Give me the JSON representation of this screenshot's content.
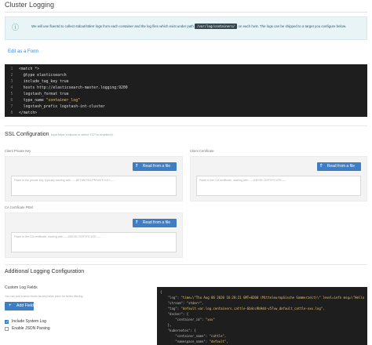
{
  "page": {
    "title": "Cluster Logging"
  },
  "info": {
    "text_before": "We will use fluentd to collect stdout/stderr logs from each container and the log files which exist under path ",
    "path": "/var/log/containers/",
    "text_after": " on each host. The logs can be shipped to a target you configure below."
  },
  "edit_link": "Edit as a Form",
  "editor": {
    "lines": [
      {
        "n": "1",
        "text": "<match *>"
      },
      {
        "n": "2",
        "text": "  @type elasticsearch"
      },
      {
        "n": "3",
        "text": "  include_tag_key true"
      },
      {
        "n": "4",
        "text": "  hosts http://elasticsearch-master.logging:9200"
      },
      {
        "n": "5",
        "text": "  logstash_format true"
      },
      {
        "n": "6",
        "text": "  type_name \"container_log\""
      },
      {
        "n": "7",
        "text": "  logstash_prefix logstash-int-cluster"
      },
      {
        "n": "8",
        "text": "</match>"
      }
    ]
  },
  "ssl": {
    "title": "SSL Configuration",
    "subtitle": "Input https endpoint or select TCP to enabled it.",
    "client_key": {
      "label": "Client Private Key",
      "button": "Read from a file",
      "placeholder": "Paste in the private key, typically starting with -----BEGIN RSA PRIVATE KEY-----"
    },
    "client_cert": {
      "label": "Client Certificate",
      "button": "Read from a file",
      "placeholder": "Paste in the CA certificate, starting with -----BEGIN CERTIFICATE-----"
    },
    "ca_cert": {
      "label": "CA Certificate PEM",
      "button": "Read from a file",
      "placeholder": "Paste in the CA certificate, starting with -----BEGIN CERTIFICATE-----"
    }
  },
  "additional": {
    "title": "Additional Logging Configuration",
    "fields_label": "Custom Log Fields",
    "fields_help": "You can add custom fields as key/value pairs for better filtering",
    "add_field": "Add Field",
    "include_system_log": "Include System Log",
    "include_system_log_checked": true,
    "enable_json": "Enable JSON Parsing",
    "enable_json_checked": false
  },
  "preview": {
    "lines": [
      "{",
      "    \"log\": \"time=\\\"Thu Aug 06 2020 16:28:21 GMT+0200 (Mitteleuropäische Sommerzeit)\\\" level=info msg=\\\"Hello World\\\"\",",
      "    \"stream\": \"stderr\",",
      "    \"tag\": \"default.var.log.containers.cattle-6b4cc9b9dd-v57vw_default_cattle-xxx.log\",",
      "    \"docker\": {",
      "        \"container_id\": \"xxx\"",
      "    },",
      "    \"kubernetes\": {",
      "        \"container_name\": \"cattle\",",
      "        \"namespace_name\": \"default\","
    ]
  },
  "colors": {
    "accent": "#3d7ec4",
    "info_bg": "#e8f4f6",
    "editor_bg": "#1e1e1e",
    "string": "#e6c67a"
  }
}
